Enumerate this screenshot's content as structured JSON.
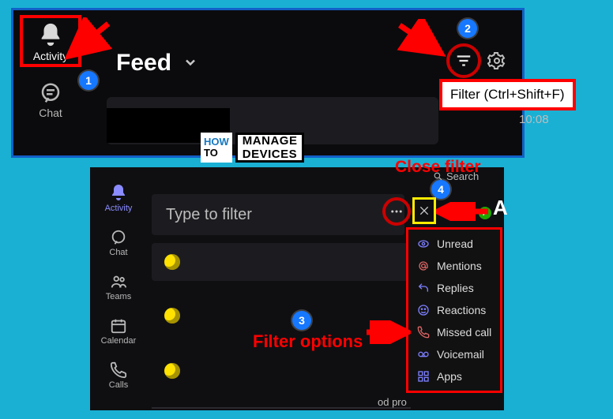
{
  "panel1": {
    "rail": {
      "activity": "Activity",
      "chat": "Chat"
    },
    "feed_title": "Feed",
    "feed_time": "10:08",
    "tooltip": "Filter (Ctrl+Shift+F)"
  },
  "logo": {
    "how": "HOW",
    "to": "TO",
    "manage": "MANAGE",
    "devices": "DEVICES"
  },
  "panel2": {
    "rail": {
      "activity": "Activity",
      "chat": "Chat",
      "teams": "Teams",
      "calendar": "Calendar",
      "calls": "Calls"
    },
    "type_placeholder": "Type to filter",
    "search": "Search",
    "bigA": "A",
    "bottom_text": "od pro"
  },
  "labels": {
    "close_filter": "Close filter",
    "filter_options": "Filter options"
  },
  "badges": {
    "n1": "1",
    "n2": "2",
    "n3": "3",
    "n4": "4"
  },
  "filter_menu": {
    "items": [
      {
        "label": "Unread"
      },
      {
        "label": "Mentions"
      },
      {
        "label": "Replies"
      },
      {
        "label": "Reactions"
      },
      {
        "label": "Missed call"
      },
      {
        "label": "Voicemail"
      },
      {
        "label": "Apps"
      }
    ]
  }
}
